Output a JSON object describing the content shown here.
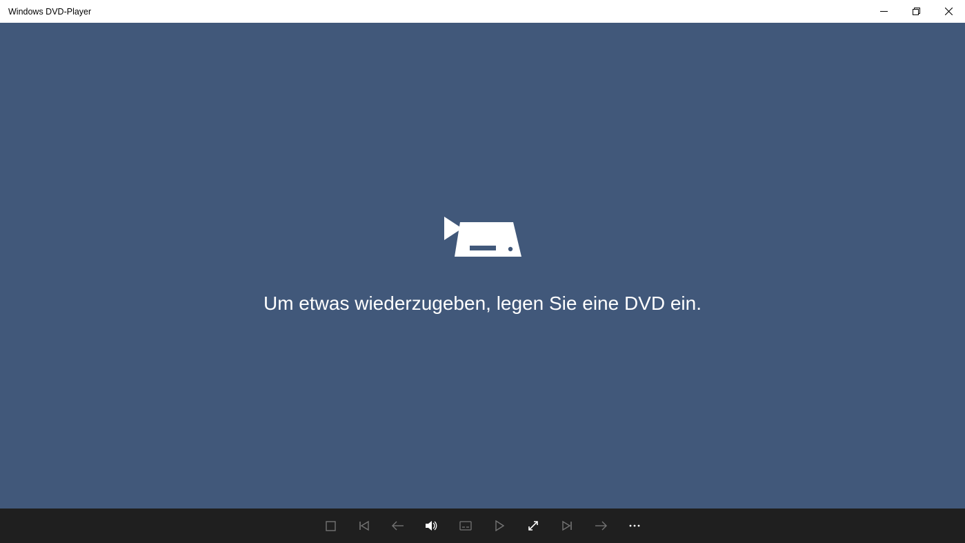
{
  "titlebar": {
    "title": "Windows DVD-Player"
  },
  "content": {
    "message": "Um etwas wiederzugeben, legen Sie eine DVD ein."
  },
  "colors": {
    "background": "#41587a",
    "controlbar": "#1f1f1f",
    "titlebar": "#ffffff"
  }
}
